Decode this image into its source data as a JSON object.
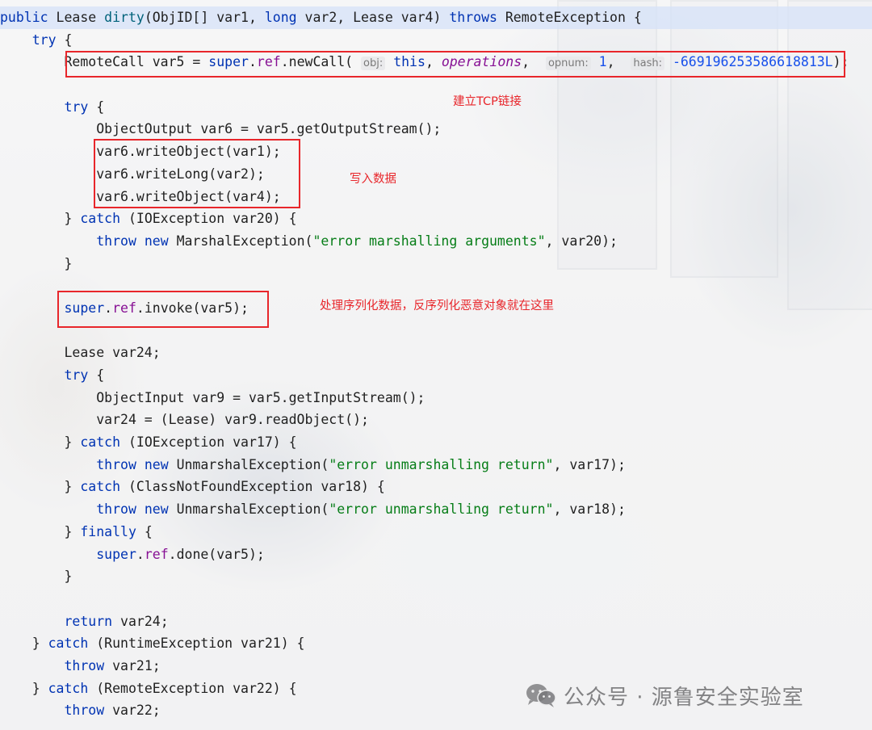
{
  "code_lines": [
    {
      "tokens": [
        {
          "t": "public ",
          "c": "k"
        },
        {
          "t": "Lease "
        },
        {
          "t": "dirty",
          "c": "m"
        },
        {
          "t": "(ObjID[] var1, "
        },
        {
          "t": "long ",
          "c": "k"
        },
        {
          "t": "var2, Lease var4) "
        },
        {
          "t": "throws ",
          "c": "k"
        },
        {
          "t": "RemoteException {"
        }
      ],
      "highlight": true
    },
    {
      "tokens": [
        {
          "t": "    "
        },
        {
          "t": "try",
          "c": "k"
        },
        {
          "t": " {"
        }
      ]
    },
    {
      "tokens": [
        {
          "t": "        RemoteCall var5 = "
        },
        {
          "t": "super",
          "c": "k"
        },
        {
          "t": "."
        },
        {
          "t": "ref",
          "c": "f"
        },
        {
          "t": ".newCall( "
        },
        {
          "t": "obj:",
          "c": "hint"
        },
        {
          "t": " "
        },
        {
          "t": "this",
          "c": "k"
        },
        {
          "t": ", "
        },
        {
          "t": "operations",
          "c": "i"
        },
        {
          "t": ",  "
        },
        {
          "t": "opnum:",
          "c": "hint"
        },
        {
          "t": " "
        },
        {
          "t": "1",
          "c": "n"
        },
        {
          "t": ",  "
        },
        {
          "t": "hash:",
          "c": "hint"
        },
        {
          "t": " "
        },
        {
          "t": "-669196253586618813L",
          "c": "n"
        },
        {
          "t": ");"
        }
      ]
    },
    {
      "tokens": []
    },
    {
      "tokens": [
        {
          "t": "        "
        },
        {
          "t": "try",
          "c": "k"
        },
        {
          "t": " {"
        }
      ]
    },
    {
      "tokens": [
        {
          "t": "            ObjectOutput var6 = var5.getOutputStream();"
        }
      ]
    },
    {
      "tokens": [
        {
          "t": "            var6.writeObject(var1);"
        }
      ]
    },
    {
      "tokens": [
        {
          "t": "            var6.writeLong(var2);"
        }
      ]
    },
    {
      "tokens": [
        {
          "t": "            var6.writeObject(var4);"
        }
      ]
    },
    {
      "tokens": [
        {
          "t": "        } "
        },
        {
          "t": "catch",
          "c": "k"
        },
        {
          "t": " (IOException var20) {"
        }
      ]
    },
    {
      "tokens": [
        {
          "t": "            "
        },
        {
          "t": "throw new ",
          "c": "k"
        },
        {
          "t": "MarshalException("
        },
        {
          "t": "\"error marshalling arguments\"",
          "c": "s"
        },
        {
          "t": ", var20);"
        }
      ]
    },
    {
      "tokens": [
        {
          "t": "        }"
        }
      ]
    },
    {
      "tokens": []
    },
    {
      "tokens": [
        {
          "t": "        "
        },
        {
          "t": "super",
          "c": "k"
        },
        {
          "t": "."
        },
        {
          "t": "ref",
          "c": "f"
        },
        {
          "t": ".invoke(var5);"
        }
      ]
    },
    {
      "tokens": []
    },
    {
      "tokens": [
        {
          "t": "        Lease var24;"
        }
      ]
    },
    {
      "tokens": [
        {
          "t": "        "
        },
        {
          "t": "try",
          "c": "k"
        },
        {
          "t": " {"
        }
      ]
    },
    {
      "tokens": [
        {
          "t": "            ObjectInput var9 = var5.getInputStream();"
        }
      ]
    },
    {
      "tokens": [
        {
          "t": "            var24 = (Lease) var9.readObject();"
        }
      ]
    },
    {
      "tokens": [
        {
          "t": "        } "
        },
        {
          "t": "catch",
          "c": "k"
        },
        {
          "t": " (IOException var17) {"
        }
      ]
    },
    {
      "tokens": [
        {
          "t": "            "
        },
        {
          "t": "throw new ",
          "c": "k"
        },
        {
          "t": "UnmarshalException("
        },
        {
          "t": "\"error unmarshalling return\"",
          "c": "s"
        },
        {
          "t": ", var17);"
        }
      ]
    },
    {
      "tokens": [
        {
          "t": "        } "
        },
        {
          "t": "catch",
          "c": "k"
        },
        {
          "t": " (ClassNotFoundException var18) {"
        }
      ]
    },
    {
      "tokens": [
        {
          "t": "            "
        },
        {
          "t": "throw new ",
          "c": "k"
        },
        {
          "t": "UnmarshalException("
        },
        {
          "t": "\"error unmarshalling return\"",
          "c": "s"
        },
        {
          "t": ", var18);"
        }
      ]
    },
    {
      "tokens": [
        {
          "t": "        } "
        },
        {
          "t": "finally",
          "c": "k"
        },
        {
          "t": " {"
        }
      ]
    },
    {
      "tokens": [
        {
          "t": "            "
        },
        {
          "t": "super",
          "c": "k"
        },
        {
          "t": "."
        },
        {
          "t": "ref",
          "c": "f"
        },
        {
          "t": ".done(var5);"
        }
      ]
    },
    {
      "tokens": [
        {
          "t": "        }"
        }
      ]
    },
    {
      "tokens": []
    },
    {
      "tokens": [
        {
          "t": "        "
        },
        {
          "t": "return ",
          "c": "k"
        },
        {
          "t": "var24;"
        }
      ]
    },
    {
      "tokens": [
        {
          "t": "    } "
        },
        {
          "t": "catch",
          "c": "k"
        },
        {
          "t": " (RuntimeException var21) {"
        }
      ]
    },
    {
      "tokens": [
        {
          "t": "        "
        },
        {
          "t": "throw ",
          "c": "k"
        },
        {
          "t": "var21;"
        }
      ]
    },
    {
      "tokens": [
        {
          "t": "    } "
        },
        {
          "t": "catch",
          "c": "k"
        },
        {
          "t": " (RemoteException var22) {"
        }
      ]
    },
    {
      "tokens": [
        {
          "t": "        "
        },
        {
          "t": "throw ",
          "c": "k"
        },
        {
          "t": "var22;"
        }
      ]
    }
  ],
  "annotations": {
    "tcp_note": "建立TCP链接",
    "write_note": "写入数据",
    "invoke_note": "处理序列化数据，反序列化恶意对象就在这里"
  },
  "watermark": {
    "text": "公众号 · 源鲁安全实验室",
    "icon": "wechat-icon"
  },
  "colors": {
    "keyword": "#0033b3",
    "method": "#00627a",
    "field": "#871094",
    "string": "#067d17",
    "number": "#1750eb",
    "annotation": "#e8262b"
  }
}
